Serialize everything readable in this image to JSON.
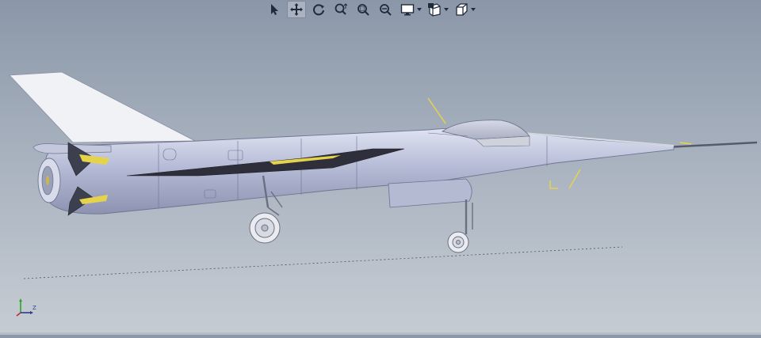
{
  "toolbar": {
    "tools": [
      {
        "icon": "select-arrow-icon",
        "active": false
      },
      {
        "icon": "pan-icon",
        "active": true
      },
      {
        "icon": "rotate-icon",
        "active": false
      },
      {
        "icon": "zoom-icon",
        "active": false
      },
      {
        "icon": "zoom-window-icon",
        "active": false
      },
      {
        "icon": "zoom-fit-icon",
        "active": false
      },
      {
        "icon": "display-mode-icon",
        "active": false,
        "dropdown": true
      },
      {
        "icon": "section-view-icon",
        "active": false,
        "dropdown": true
      },
      {
        "icon": "view-orientation-icon",
        "active": false,
        "dropdown": true
      }
    ]
  },
  "viewport": {
    "model": "aircraft-3d-model",
    "colors": {
      "background_top": "#8b97a8",
      "background_bottom": "#c6ccd3",
      "fuselage": "#b9bfd8",
      "wing": "#eef0f6",
      "highlight": "#e6d34c"
    }
  },
  "triad": {
    "axis_label": "Z"
  }
}
